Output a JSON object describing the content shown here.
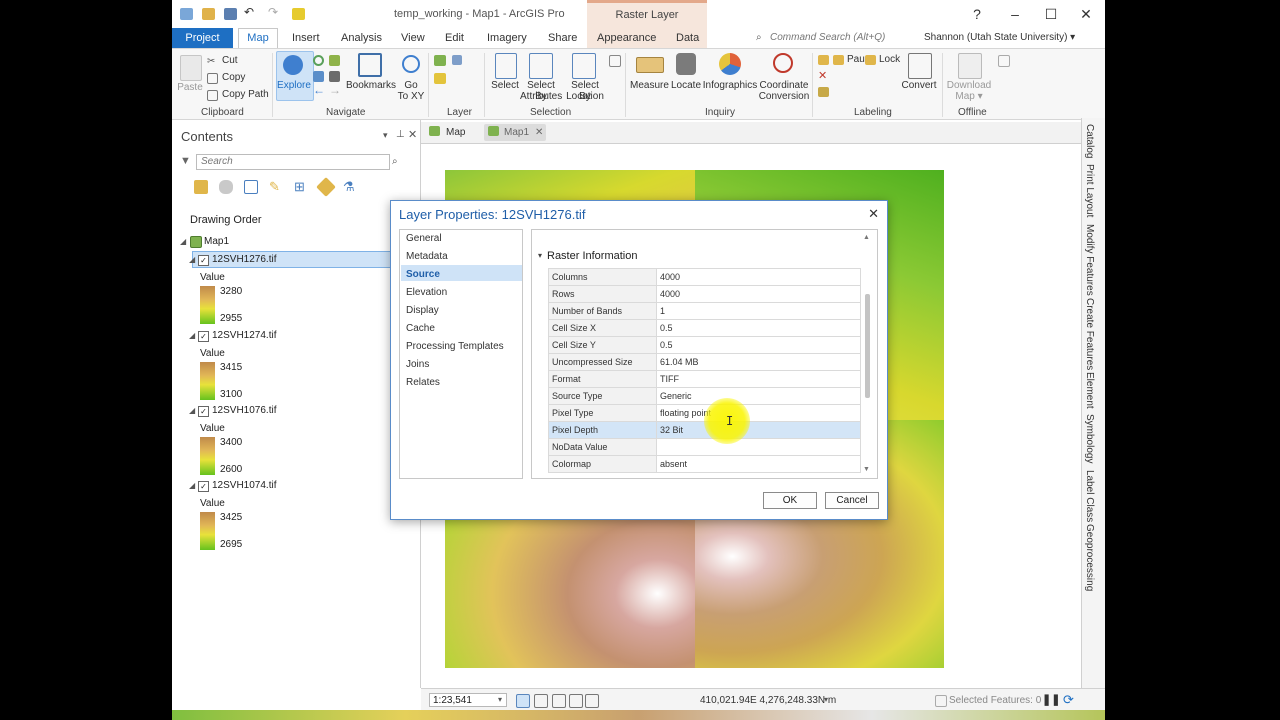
{
  "window": {
    "title": "temp_working - Map1 - ArcGIS Pro",
    "context_tab": "Raster Layer",
    "help": "?",
    "minimize": "–",
    "maximize": "☐",
    "close": "✕"
  },
  "ribbon_tabs": [
    "Project",
    "Map",
    "Insert",
    "Analysis",
    "View",
    "Edit",
    "Imagery",
    "Share",
    "Appearance",
    "Data"
  ],
  "command_search": {
    "placeholder": "Command Search (Alt+Q)"
  },
  "user": "Shannon (Utah State University) ▾",
  "ribbon": {
    "clipboard": {
      "paste": "Paste",
      "cut": "Cut",
      "copy": "Copy",
      "copy_path": "Copy Path",
      "group": "Clipboard"
    },
    "navigate": {
      "explore": "Explore",
      "bookmarks": "Bookmarks",
      "go_to_xy_1": "Go",
      "go_to_xy_2": "To XY",
      "group": "Navigate"
    },
    "layer": {
      "group": "Layer"
    },
    "selection": {
      "select": "Select",
      "by_attr_1": "Select By",
      "by_attr_2": "Attributes",
      "by_loc_1": "Select By",
      "by_loc_2": "Location",
      "group": "Selection"
    },
    "inquiry": {
      "measure": "Measure",
      "locate": "Locate",
      "infographics": "Infographics",
      "coord_1": "Coordinate",
      "coord_2": "Conversion",
      "group": "Inquiry"
    },
    "labeling": {
      "pause": "Pause",
      "lock": "Lock",
      "convert": "Convert",
      "group": "Labeling"
    },
    "offline": {
      "download_1": "Download",
      "download_2": "Map ▾",
      "group": "Offline"
    }
  },
  "contents": {
    "title": "Contents",
    "search_placeholder": "Search",
    "drawing_order": "Drawing Order",
    "map_name": "Map1",
    "layers": [
      {
        "name": "12SVH1276.tif",
        "value_label": "Value",
        "max": "3280",
        "min": "2955",
        "checked": true
      },
      {
        "name": "12SVH1274.tif",
        "value_label": "Value",
        "max": "3415",
        "min": "3100",
        "checked": true
      },
      {
        "name": "12SVH1076.tif",
        "value_label": "Value",
        "max": "3400",
        "min": "2600",
        "checked": true
      },
      {
        "name": "12SVH1074.tif",
        "value_label": "Value",
        "max": "3425",
        "min": "2695",
        "checked": true
      }
    ]
  },
  "map_tabs": [
    {
      "label": "Map"
    },
    {
      "label": "Map1"
    }
  ],
  "dock": [
    "Catalog",
    "Print Layout",
    "Modify Features",
    "Create Features",
    "Element",
    "Symbology",
    "Label Class",
    "Geoprocessing"
  ],
  "dialog": {
    "title": "Layer Properties: 12SVH1276.tif",
    "nav": [
      "General",
      "Metadata",
      "Source",
      "Elevation",
      "Display",
      "Cache",
      "Processing Templates",
      "Joins",
      "Relates"
    ],
    "selected_nav": "Source",
    "section": "Raster Information",
    "properties": [
      {
        "key": "Columns",
        "value": "4000"
      },
      {
        "key": "Rows",
        "value": "4000"
      },
      {
        "key": "Number of Bands",
        "value": "1"
      },
      {
        "key": "Cell Size X",
        "value": "0.5"
      },
      {
        "key": "Cell Size Y",
        "value": "0.5"
      },
      {
        "key": "Uncompressed Size",
        "value": "61.04 MB"
      },
      {
        "key": "Format",
        "value": "TIFF"
      },
      {
        "key": "Source Type",
        "value": "Generic"
      },
      {
        "key": "Pixel Type",
        "value": "floating point"
      },
      {
        "key": "Pixel Depth",
        "value": "32 Bit"
      },
      {
        "key": "NoData Value",
        "value": ""
      },
      {
        "key": "Colormap",
        "value": "absent"
      }
    ],
    "highlighted_row": "Pixel Depth",
    "ok": "OK",
    "cancel": "Cancel"
  },
  "status": {
    "scale": "1:23,541",
    "coordinates": "410,021.94E 4,276,248.33N m",
    "selected_features": "Selected Features: 0"
  },
  "colors": {
    "accent": "#1e6fc3",
    "context_tab": "#f6e6dc"
  }
}
